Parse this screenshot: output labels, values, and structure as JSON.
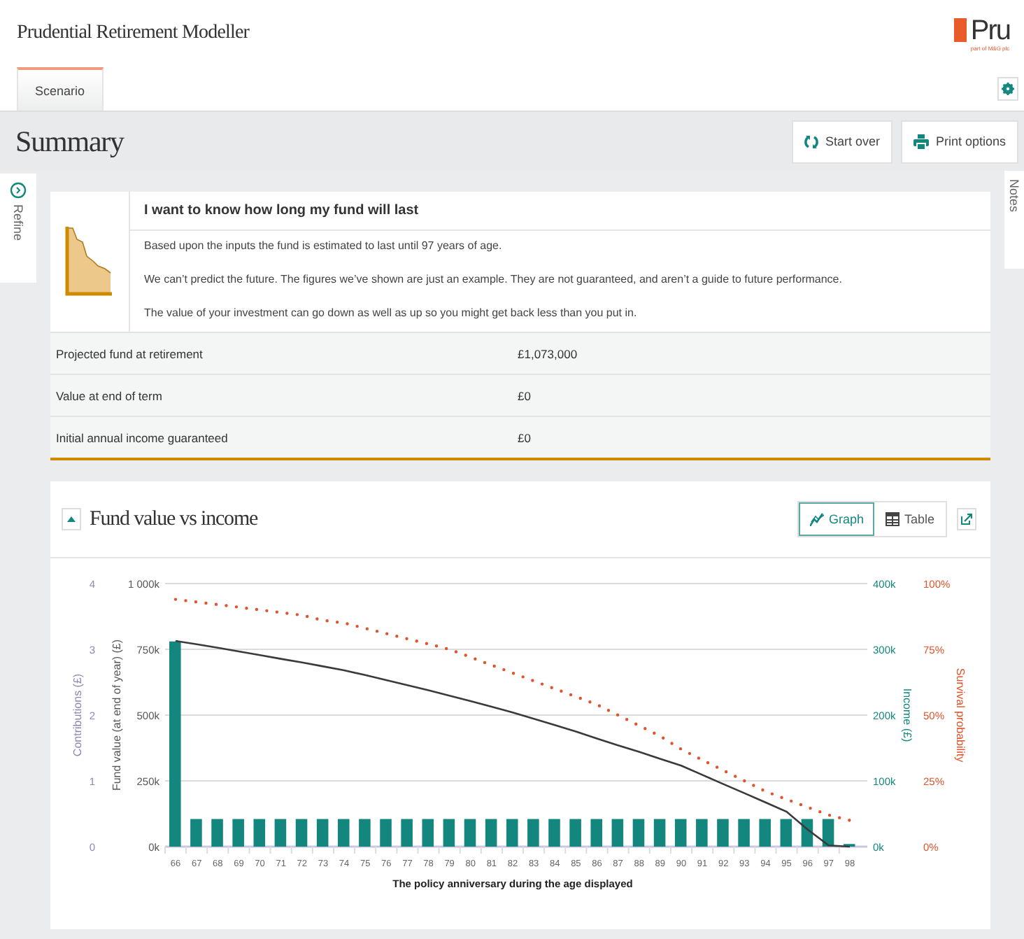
{
  "header": {
    "title": "Prudential Retirement Modeller",
    "logo": {
      "name": "Pru",
      "tagline": "part of M&G plc"
    }
  },
  "tabs": [
    {
      "label": "Scenario",
      "selected": true
    }
  ],
  "page_title": "Summary",
  "actions": [
    {
      "label": "Start over",
      "kind": "refresh"
    },
    {
      "label": "Print options",
      "kind": "print"
    }
  ],
  "side_tabs": [
    {
      "label": "Refine",
      "kind": "left"
    },
    {
      "label": "Notes",
      "kind": "right"
    }
  ],
  "result": {
    "heading": "I want to know how long my fund will last",
    "paragraphs": [
      "Based upon the inputs the fund is estimated to last until 97 years of age.",
      "We can’t predict the future. The figures we’ve shown are just an example. They are not guaranteed, and aren’t a guide to future performance.",
      "The value of your investment can go down as well as up so you might get back less than you put in."
    ],
    "rows": [
      {
        "label": "Projected fund at retirement",
        "value": "£1,073,000"
      },
      {
        "label": "Value at end of term",
        "value": "£0"
      },
      {
        "label": "Initial annual income guaranteed",
        "value": "£0"
      }
    ]
  },
  "chart_panel": {
    "title": "Fund value vs income",
    "expanded": true,
    "views": [
      {
        "label": "Graph",
        "kind": "graph",
        "selected": true
      },
      {
        "label": "Table",
        "kind": "table",
        "selected": false
      }
    ],
    "contributions_axis": {
      "title": "Contributions (£)",
      "ticks": [
        "4",
        "3",
        "2",
        "1",
        "0"
      ]
    },
    "chart_data": {
      "type": "bar",
      "grid": true,
      "xlabel": "The policy anniversary during the age displayed",
      "categories": [
        "66",
        "67",
        "68",
        "69",
        "70",
        "71",
        "72",
        "73",
        "74",
        "75",
        "76",
        "77",
        "78",
        "79",
        "80",
        "81",
        "82",
        "83",
        "84",
        "85",
        "86",
        "87",
        "88",
        "89",
        "90",
        "91",
        "92",
        "93",
        "94",
        "95",
        "96",
        "97",
        "98"
      ],
      "ylabel": "Fund value (at end of year) (£)",
      "ylim": [
        0,
        1000
      ],
      "yticks": [
        {
          "value": 0,
          "label": "0k"
        },
        {
          "value": 250,
          "label": "250k"
        },
        {
          "value": 500,
          "label": "500k"
        },
        {
          "value": 750,
          "label": "750k"
        },
        {
          "value": 1000,
          "label": "1 000k"
        }
      ],
      "y2label": "Income (£)",
      "y2lim": [
        0,
        400
      ],
      "y2ticks": [
        {
          "value": 0,
          "label": "0k"
        },
        {
          "value": 100,
          "label": "100k"
        },
        {
          "value": 200,
          "label": "200k"
        },
        {
          "value": 300,
          "label": "300k"
        },
        {
          "value": 400,
          "label": "400k"
        }
      ],
      "y3label": "Survival probability",
      "y3lim": [
        0,
        100
      ],
      "y3ticks": [
        {
          "value": 0,
          "label": "0%"
        },
        {
          "value": 25,
          "label": "25%"
        },
        {
          "value": 50,
          "label": "50%"
        },
        {
          "value": 75,
          "label": "75%"
        },
        {
          "value": 100,
          "label": "100%"
        }
      ],
      "series": [
        {
          "axis": "y2",
          "color": "#13877e",
          "values": [
            312,
            42,
            42,
            42,
            42,
            42,
            42,
            42,
            42,
            42,
            42,
            42,
            42,
            42,
            42,
            42,
            42,
            42,
            42,
            42,
            42,
            42,
            42,
            42,
            42,
            42,
            42,
            42,
            42,
            42,
            42,
            42,
            4
          ]
        },
        {
          "type": "line",
          "color": "#3a3a3a",
          "values": [
            782,
            769,
            756,
            742,
            728,
            714,
            700,
            685,
            670,
            652,
            633,
            614,
            594,
            574,
            553,
            532,
            510,
            486,
            462,
            437,
            411,
            385,
            360,
            334,
            308,
            273,
            238,
            203,
            168,
            133,
            65,
            5,
            0
          ]
        },
        {
          "type": "line",
          "axis": "y3",
          "line_style": "dotted",
          "color": "#e0532b",
          "values": [
            94,
            93,
            92,
            91,
            90,
            89,
            88,
            86,
            85,
            83,
            81,
            79,
            77,
            75,
            72,
            69,
            66,
            63,
            60,
            57,
            54,
            50,
            46,
            42,
            37,
            33,
            29,
            25,
            21,
            18,
            15,
            12,
            10
          ]
        }
      ]
    }
  }
}
